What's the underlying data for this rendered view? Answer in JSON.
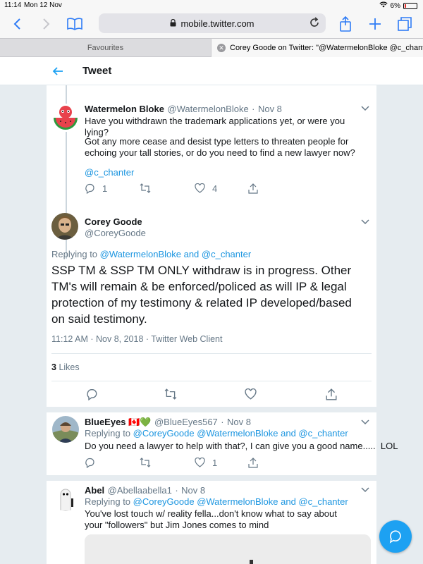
{
  "status": {
    "time": "11:14",
    "date": "Mon 12 Nov",
    "battery": "6%"
  },
  "browser": {
    "url": "mobile.twitter.com",
    "tabs": [
      {
        "label": "Favourites"
      },
      {
        "label": "Corey Goode on Twitter: \"@WatermelonBloke @c_chant..."
      }
    ]
  },
  "header": {
    "title": "Tweet"
  },
  "parent_tweet": {
    "name": "Watermelon Bloke",
    "handle": "@WatermelonBloke",
    "sep": "·",
    "date": "Nov 8",
    "line1": "Have you withdrawn the trademark applications yet, or were you lying?",
    "line2": "Got any more cease and desist type letters to threaten people for echoing your tall stories, or do you need to find a new lawyer now?",
    "mention": "@c_chanter",
    "replies": "1",
    "likes": "4"
  },
  "main_tweet": {
    "name": "Corey Goode",
    "handle": "@CoreyGoode",
    "replying_prefix": "Replying to",
    "replying_to": "@WatermelonBloke and @c_chanter",
    "text": "SSP TM & SSP TM ONLY withdraw is in progress. Other TM's will remain & be enforced/policed as will IP & legal protection of my testimony & related IP developed/based on said testimony.",
    "timestamp": "11:12 AM · Nov 8, 2018 · Twitter Web Client",
    "like_count": "3",
    "like_label": "Likes"
  },
  "replies": [
    {
      "name": "BlueEyes 🇨🇦💚",
      "handle": "@BlueEyes567",
      "sep": "·",
      "date": "Nov 8",
      "replying_prefix": "Replying to",
      "replying_to": "@CoreyGoode @WatermelonBloke and @c_chanter",
      "text": "Do you need a lawyer to help with that?, I can give you a good name.....  LOL",
      "likes": "1"
    },
    {
      "name": "Abel",
      "handle": "@Abellaabella1",
      "sep": "·",
      "date": "Nov 8",
      "replying_prefix": "Replying to",
      "replying_to": "@CoreyGoode @WatermelonBloke and @c_chanter",
      "text": "You've lost touch w/ reality fella...don't know what to say about your \"followers\" but Jim Jones comes to mind"
    }
  ],
  "icons": {
    "back": "chevron-left-icon",
    "forward": "chevron-right-icon",
    "bookmarks": "book-icon",
    "share": "share-icon",
    "new_tab": "plus-icon",
    "tabs": "tabs-icon",
    "reply": "reply-icon",
    "retweet": "retweet-icon",
    "like": "heart-icon",
    "share_tweet": "share-icon",
    "compose": "compose-icon"
  },
  "colors": {
    "accent": "#1da1f2",
    "link": "#1b95e0",
    "safari": "#2f7cf6"
  }
}
